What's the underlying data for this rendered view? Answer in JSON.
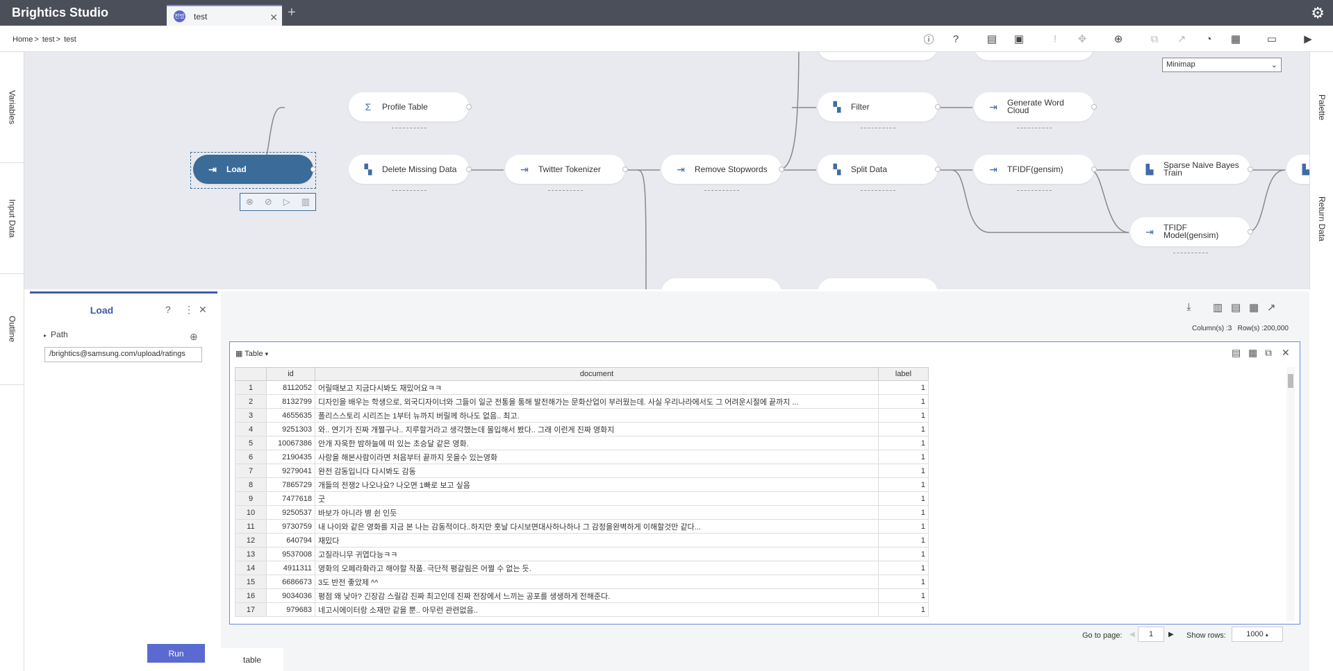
{
  "app": {
    "title": "Brightics Studio",
    "tab_label": "test",
    "tab_avatar": "전망"
  },
  "breadcrumb": {
    "home": "Home",
    "project": "test",
    "model": "test",
    "sep": ">"
  },
  "left_rail": [
    "Variables",
    "Input Data",
    "Outline"
  ],
  "right_rail": [
    "Palette",
    "Return Data"
  ],
  "minimap": {
    "label": "Minimap"
  },
  "nodes": {
    "load": "Load",
    "profile": "Profile Table",
    "delete_missing": "Delete Missing Data",
    "twitter": "Twitter Tokenizer",
    "remove_stop": "Remove Stopwords",
    "filter": "Filter",
    "generate_wc": "Generate Word Cloud",
    "split": "Split Data",
    "tfidf": "TFIDF(gensim)",
    "snb": "Sparse Naive Bayes Train",
    "tfidf_model": "TFIDF Model(gensim)"
  },
  "panel": {
    "title": "Load",
    "path_label": "Path",
    "path_value": "/brightics@samsung.com/upload/ratings",
    "run_label": "Run"
  },
  "result": {
    "columns_text": "Column(s) :3",
    "rows_text": "Row(s) :200,000",
    "table_label": "Table",
    "bottom_tab": "table"
  },
  "table": {
    "headers": [
      "id",
      "document",
      "label"
    ],
    "rows": [
      [
        "1",
        "8112052",
        "어릴때보고 지금다시봐도 재밌어요ㅋㅋ",
        "1"
      ],
      [
        "2",
        "8132799",
        "디자인을 배우는 학생으로, 외국디자이너와 그들이 일군 전통을 통해 발전해가는 문화산업이 부러웠는데. 사실 우리나라에서도 그 어려운시절에 끝까지 ...",
        "1"
      ],
      [
        "3",
        "4655635",
        "폴리스스토리 시리즈는 1부터 뉴까지 버릴께 하나도 없음.. 최고.",
        "1"
      ],
      [
        "4",
        "9251303",
        "와.. 연기가 진짜 개쩔구나.. 지루할거라고 생각했는데 몰입해서 봤다.. 그래 이런게 진짜 영화지",
        "1"
      ],
      [
        "5",
        "10067386",
        "안개 자욱한 밤하늘에 떠 있는 초승달 같은 영화.",
        "1"
      ],
      [
        "6",
        "2190435",
        "사랑을 해본사람이라면 처음부터 끝까지 웃을수 있는영화",
        "1"
      ],
      [
        "7",
        "9279041",
        "완전 감동입니다 다시봐도 감동",
        "1"
      ],
      [
        "8",
        "7865729",
        "개들의 전쟁2 나오나요? 나오면 1빠로 보고 싶음",
        "1"
      ],
      [
        "9",
        "7477618",
        "굿",
        "1"
      ],
      [
        "10",
        "9250537",
        "바보가 아니라 병 쉰 인듯",
        "1"
      ],
      [
        "11",
        "9730759",
        "내 나이와 같은 영화를 지금 본 나는 감동적이다..하지만 훗날 다시보면대사하나하나 그 감정을완벽하게 이해할것만 같다...",
        "1"
      ],
      [
        "12",
        "640794",
        "재밌다",
        "1"
      ],
      [
        "13",
        "9537008",
        "고질라니무 귀엽다능ㅋㅋ",
        "1"
      ],
      [
        "14",
        "4911311",
        "영화의 오페라화라고 해야할 작품. 극단적 평갈림은 어쩔 수 없는 듯.",
        "1"
      ],
      [
        "15",
        "6686673",
        "3도 반전 좋았제 ^^",
        "1"
      ],
      [
        "16",
        "9034036",
        "평점 왜 낮아? 긴장감 스릴감 진짜 최고인데 진짜 전장에서 느끼는 공포를 생생하게 전해준다.",
        "1"
      ],
      [
        "17",
        "979683",
        "네고시에이터랑 소재만 같을 뿐.. 아무런 관련없음..",
        "1"
      ]
    ]
  },
  "pager": {
    "goto_label": "Go to page:",
    "page": "1",
    "show_rows_label": "Show rows:",
    "rows": "1000"
  }
}
